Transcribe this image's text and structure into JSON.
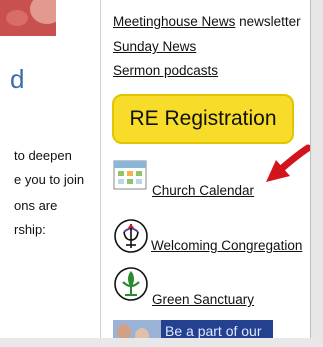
{
  "left_column": {
    "heading": "d",
    "body_lines": [
      "to deepen",
      "e you to join",
      "ons are",
      "rship:"
    ]
  },
  "right_column": {
    "links": {
      "meetinghouse_news": "Meetinghouse News",
      "meetinghouse_suffix": " newsletter",
      "sunday_news": "Sunday News",
      "sermon_podcasts": "Sermon podcasts"
    },
    "re_registration_label": "RE Registration",
    "church_calendar": "Church Calendar",
    "welcoming_congregation": "Welcoming Congregation",
    "green_sanctuary": "Green Sanctuary",
    "banner_text": "Be a part of our"
  },
  "icons": {
    "calendar": "calendar-icon",
    "welcoming": "chalice-icon",
    "green": "green-chalice-icon",
    "arrow": "red-arrow"
  },
  "colors": {
    "re_button": "#f7dc2a",
    "heading": "#3a6da8",
    "arrow": "#d4141d",
    "banner": "#23418f",
    "green_chalice": "#2a8a2e"
  }
}
